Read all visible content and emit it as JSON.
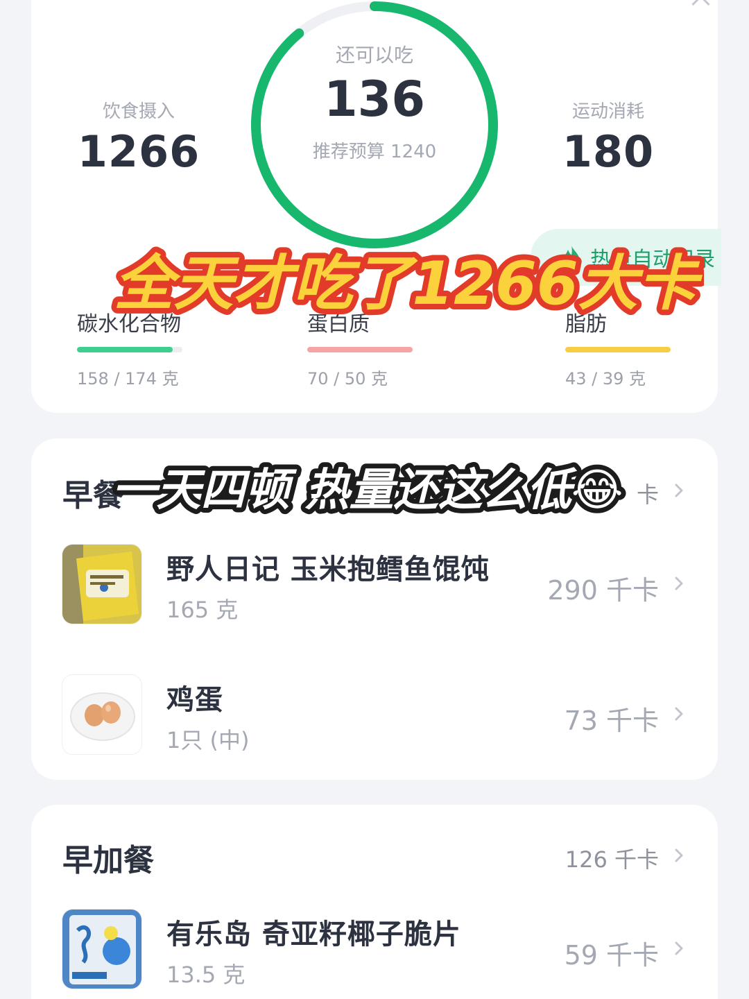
{
  "summary": {
    "intake_label": "饮食摄入",
    "intake_value": "1266",
    "remaining_label": "还可以吃",
    "remaining_value": "136",
    "budget_text": "推荐预算 1240",
    "remaining_progress_fraction": 0.89,
    "exercise_label": "运动消耗",
    "exercise_value": "180",
    "auto_record_label": "热量自动记录",
    "accent_color": "#17b86e"
  },
  "macros": [
    {
      "name": "碳水化合物",
      "amount": "158 / 174 克",
      "fill_fraction": 0.91,
      "color": "#3ccf8e"
    },
    {
      "name": "蛋白质",
      "amount": "70 / 50 克",
      "fill_fraction": 1.0,
      "color": "#f5a3a3"
    },
    {
      "name": "脂肪",
      "amount": "43 / 39 克",
      "fill_fraction": 1.0,
      "color": "#f7cd43"
    }
  ],
  "overlay": {
    "headline": "全天才吃了1266大卡",
    "caption": "一天四顿 热量还这么低😂"
  },
  "meals": {
    "breakfast": {
      "title": "早餐",
      "kcal": "卡",
      "items": [
        {
          "name": "野人日记 玉米抱鳕鱼馄饨",
          "amount": "165 克",
          "kcal": "290 千卡",
          "thumb": "yellow-package-icon"
        },
        {
          "name": "鸡蛋",
          "amount": "1只 (中)",
          "kcal": "73 千卡",
          "thumb": "egg-icon"
        }
      ]
    },
    "morning_snack": {
      "title": "早加餐",
      "kcal": "126 千卡",
      "items": [
        {
          "name": "有乐岛 奇亚籽椰子脆片",
          "amount": "13.5 克",
          "kcal": "59 千卡",
          "thumb": "blue-package-icon"
        }
      ]
    }
  }
}
